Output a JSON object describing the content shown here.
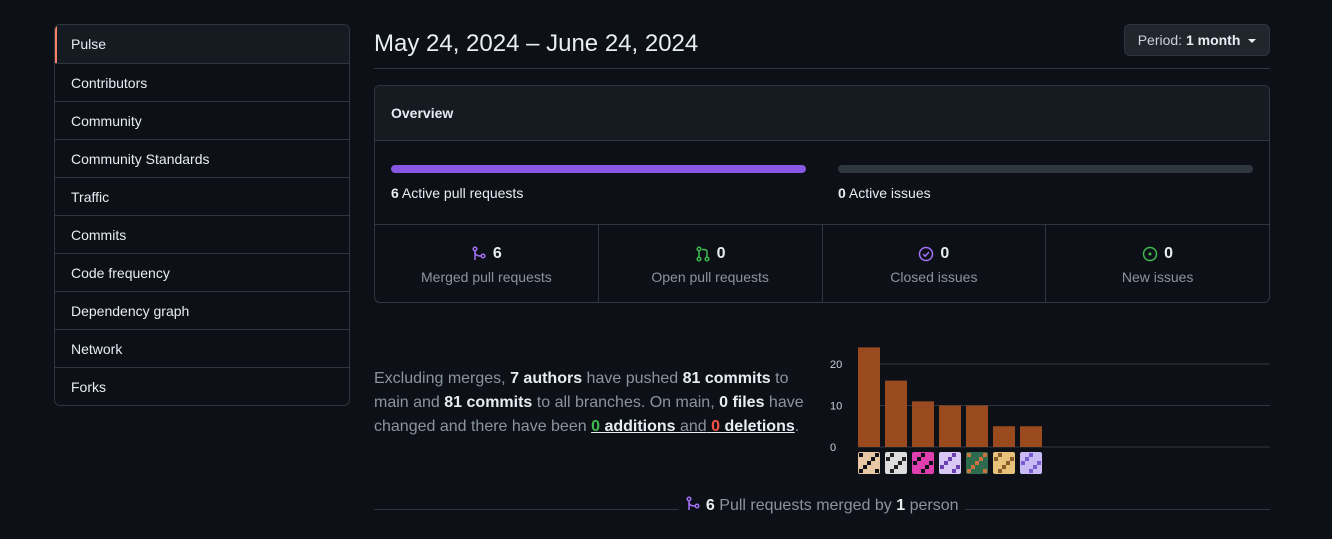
{
  "sidebar": {
    "items": [
      {
        "label": "Pulse",
        "active": true
      },
      {
        "label": "Contributors"
      },
      {
        "label": "Community"
      },
      {
        "label": "Community Standards"
      },
      {
        "label": "Traffic"
      },
      {
        "label": "Commits"
      },
      {
        "label": "Code frequency"
      },
      {
        "label": "Dependency graph"
      },
      {
        "label": "Network"
      },
      {
        "label": "Forks"
      }
    ]
  },
  "header": {
    "date_range": "May 24, 2024 – June 24, 2024",
    "period_prefix": "Period:",
    "period_value": "1 month"
  },
  "overview": {
    "title": "Overview",
    "active_prs": {
      "count": "6",
      "label": "Active pull requests",
      "fill_fraction": 1.0
    },
    "active_issues": {
      "count": "0",
      "label": "Active issues",
      "fill_fraction": 0.0
    },
    "stats": [
      {
        "count": "6",
        "label": "Merged pull requests",
        "icon": "git-merge-icon",
        "color": "#a371f7"
      },
      {
        "count": "0",
        "label": "Open pull requests",
        "icon": "git-pull-request-icon",
        "color": "#3fb950"
      },
      {
        "count": "0",
        "label": "Closed issues",
        "icon": "issue-closed-icon",
        "color": "#a371f7"
      },
      {
        "count": "0",
        "label": "New issues",
        "icon": "issue-opened-icon",
        "color": "#3fb950"
      }
    ]
  },
  "summary": {
    "p1": "Excluding merges,",
    "authors": "7 authors",
    "p2": "have pushed",
    "commits_main": "81 commits",
    "p3": "to main and",
    "commits_all": "81 commits",
    "p4": "to all branches. On main,",
    "files": "0 files",
    "p5": "have changed and there have been",
    "additions_num": "0",
    "additions_word": "additions",
    "p6": "and",
    "deletions_num": "0",
    "deletions_word": "deletions",
    "p7": "."
  },
  "chart_data": {
    "type": "bar",
    "categories": [
      "author-1",
      "author-2",
      "author-3",
      "author-4",
      "author-5",
      "author-6",
      "author-7"
    ],
    "values": [
      24,
      16,
      11,
      10,
      10,
      5,
      5
    ],
    "ylim": [
      0,
      25
    ],
    "yticks": [
      0,
      10,
      20
    ],
    "bar_color": "#9a4a1f",
    "grid": true
  },
  "footer": {
    "count": "6",
    "text1": "Pull requests merged by",
    "people": "1",
    "text2": "person"
  },
  "colors": {
    "accent_orange": "#f78166",
    "purple": "#8957e5",
    "green": "#3fb950",
    "red": "#f85149"
  }
}
